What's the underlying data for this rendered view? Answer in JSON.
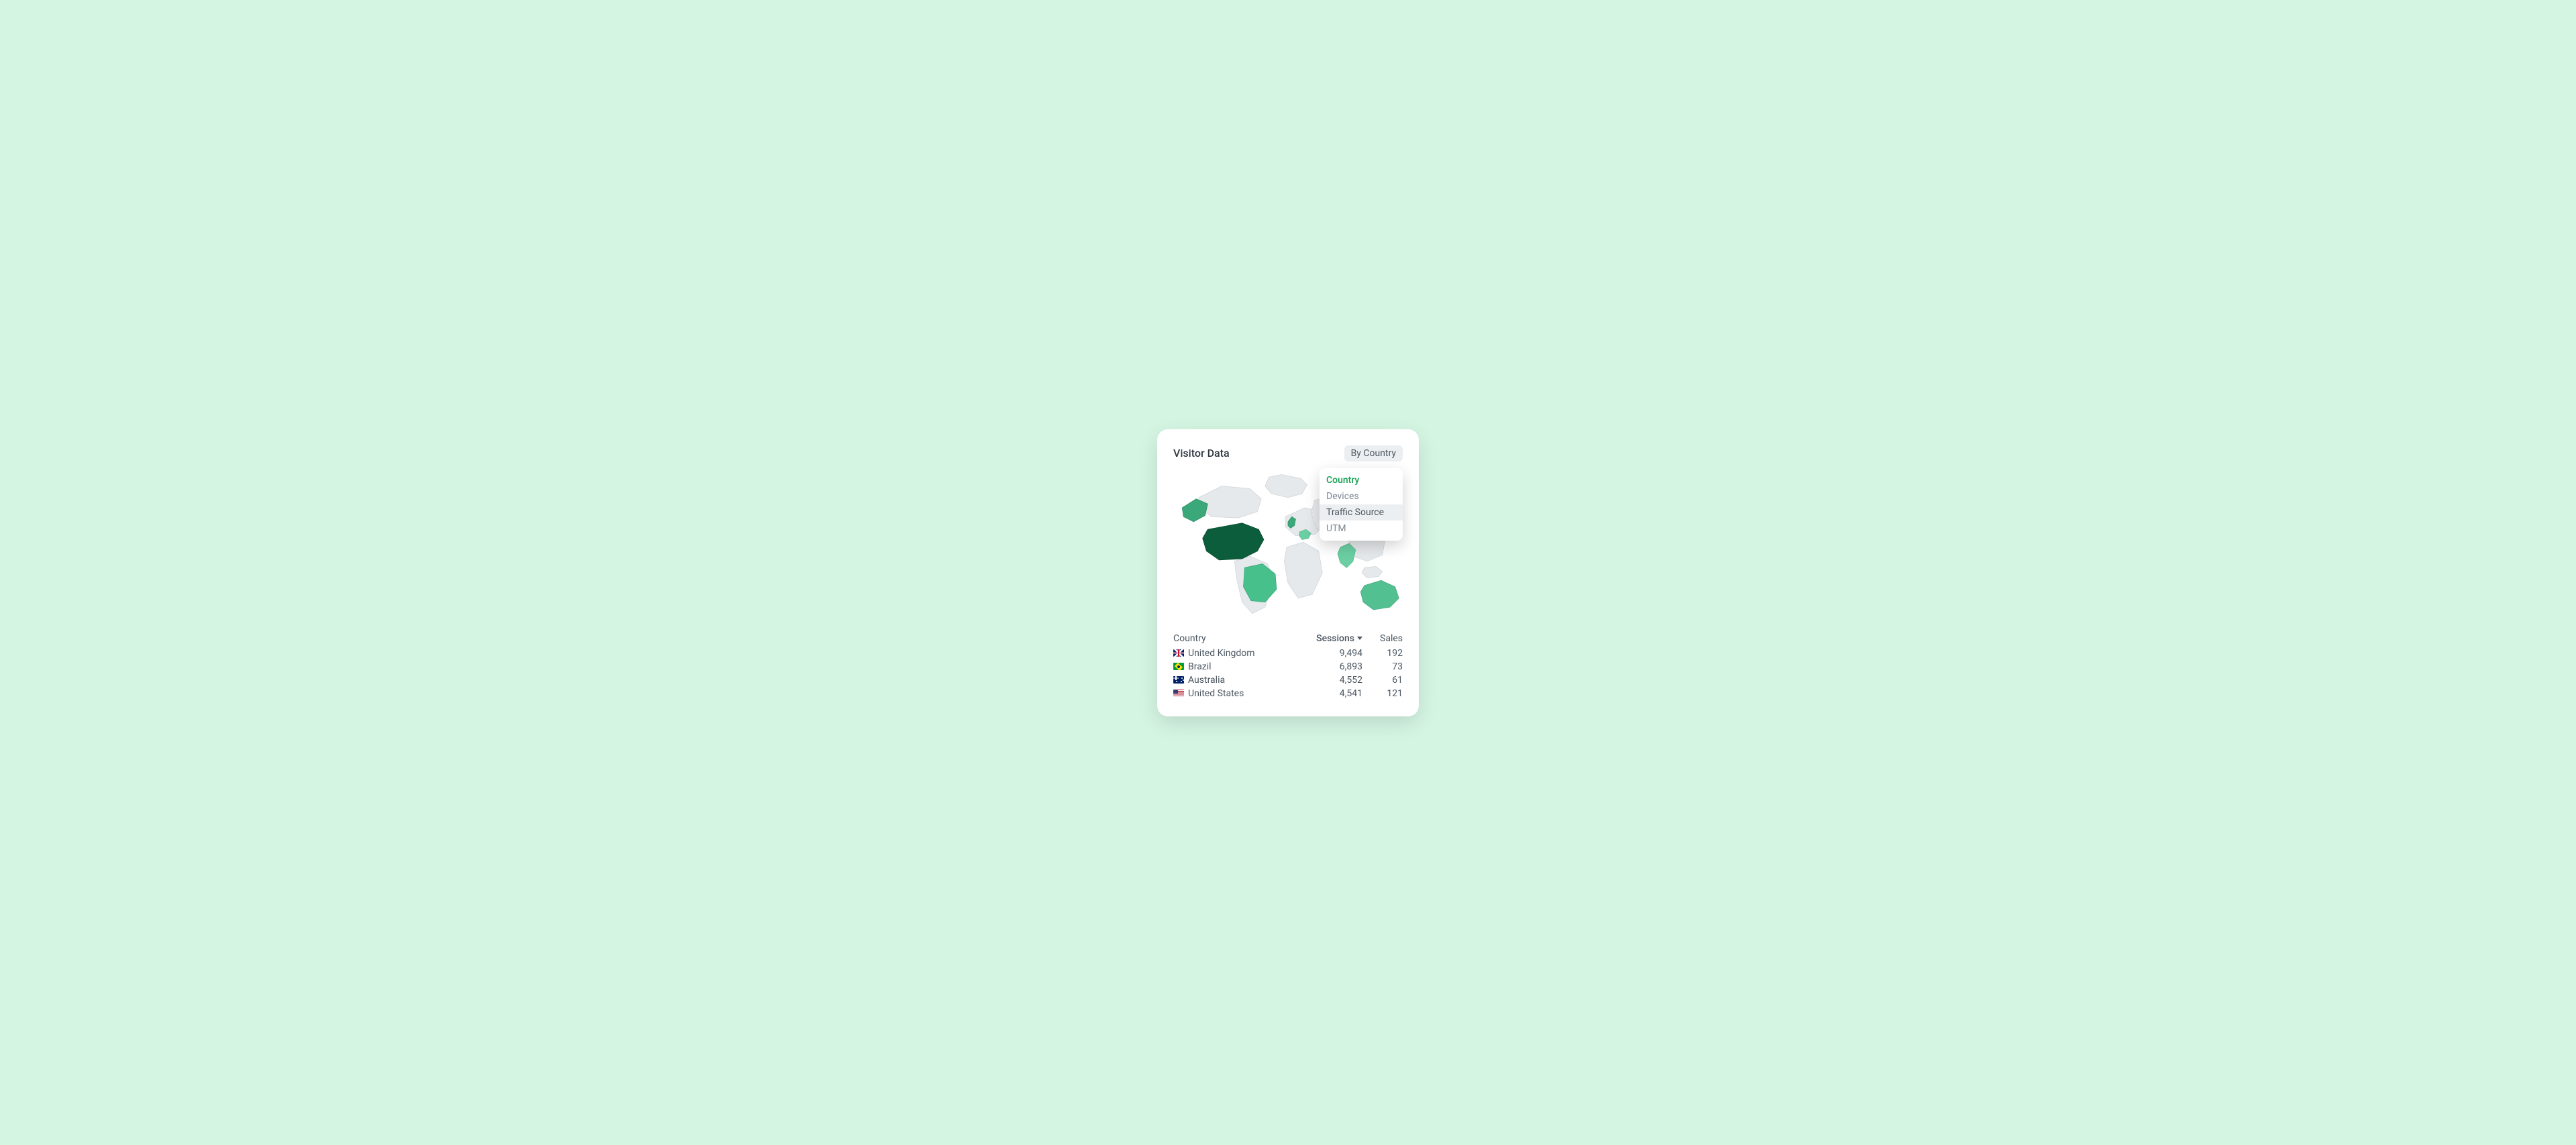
{
  "card": {
    "title": "Visitor Data",
    "filter_label": "By Country"
  },
  "dropdown": {
    "items": [
      {
        "label": "Country",
        "selected": true,
        "hovered": false
      },
      {
        "label": "Devices",
        "selected": false,
        "hovered": false
      },
      {
        "label": "Traffic Source",
        "selected": false,
        "hovered": true
      },
      {
        "label": "UTM",
        "selected": false,
        "hovered": false
      }
    ]
  },
  "table": {
    "headers": {
      "country": "Country",
      "sessions": "Sessions",
      "sales": "Sales"
    },
    "rows": [
      {
        "flag": "uk",
        "country": "United Kingdom",
        "sessions": "9,494",
        "sales": "192"
      },
      {
        "flag": "br",
        "country": "Brazil",
        "sessions": "6,893",
        "sales": "73"
      },
      {
        "flag": "au",
        "country": "Australia",
        "sessions": "4,552",
        "sales": "61"
      },
      {
        "flag": "us",
        "country": "United States",
        "sessions": "4,541",
        "sales": "121"
      }
    ]
  },
  "map": {
    "base_fill": "#e6e9eb",
    "stroke": "#d0d5d8",
    "highlights": [
      {
        "name": "north-america",
        "fill": "#0b5d3b"
      },
      {
        "name": "alaska",
        "fill": "#3aa879"
      },
      {
        "name": "brazil",
        "fill": "#47c08c"
      },
      {
        "name": "uk",
        "fill": "#3aa879"
      },
      {
        "name": "europe-spot",
        "fill": "#6bcfa3"
      },
      {
        "name": "india",
        "fill": "#6bcfa3"
      },
      {
        "name": "australia",
        "fill": "#52c091"
      }
    ]
  }
}
